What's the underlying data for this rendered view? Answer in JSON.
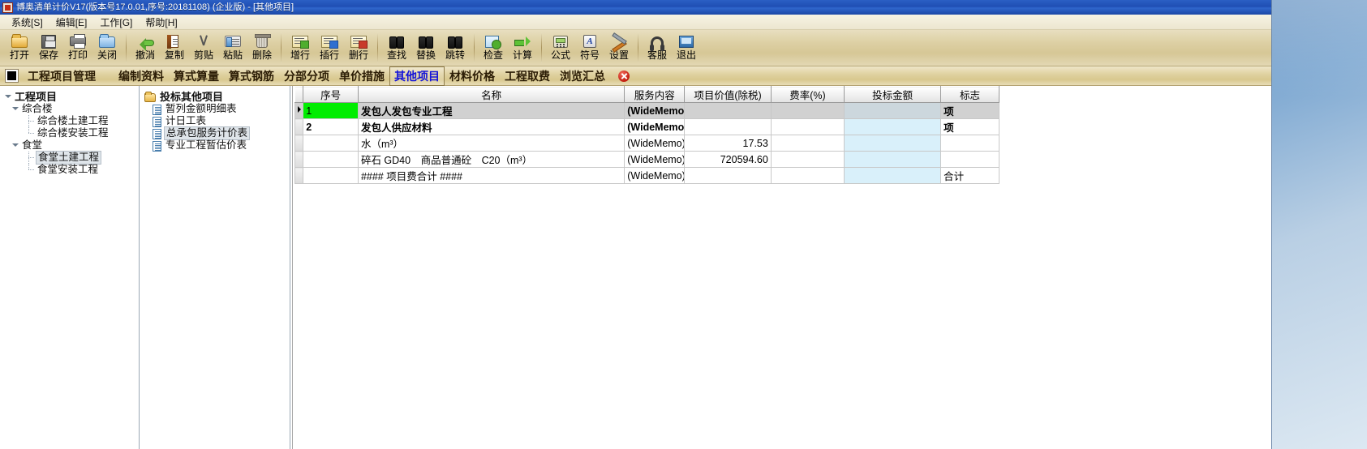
{
  "window": {
    "title": "博奥清单计价V17(版本号17.0.01,序号:20181108) (企业版) - [其他项目]",
    "app_icon": "app-logo-icon"
  },
  "menubar": {
    "items": [
      {
        "label": "系统[S]",
        "name": "menu-system"
      },
      {
        "label": "编辑[E]",
        "name": "menu-edit"
      },
      {
        "label": "工作[G]",
        "name": "menu-work"
      },
      {
        "label": "帮助[H]",
        "name": "menu-help"
      }
    ]
  },
  "toolbar": {
    "groups": [
      {
        "buttons": [
          {
            "label": "打开",
            "icon": "open-folder-icon"
          },
          {
            "label": "保存",
            "icon": "save-disk-icon"
          },
          {
            "label": "打印",
            "icon": "printer-icon"
          },
          {
            "label": "关闭",
            "icon": "close-folder-icon"
          }
        ]
      },
      {
        "buttons": [
          {
            "label": "撤消",
            "icon": "undo-arrow-icon"
          },
          {
            "label": "复制",
            "icon": "copy-icon"
          },
          {
            "label": "剪贴",
            "icon": "scissors-icon"
          },
          {
            "label": "粘贴",
            "icon": "paste-icon"
          },
          {
            "label": "删除",
            "icon": "trash-icon"
          }
        ]
      },
      {
        "buttons": [
          {
            "label": "增行",
            "icon": "add-row-icon"
          },
          {
            "label": "插行",
            "icon": "insert-row-icon"
          },
          {
            "label": "删行",
            "icon": "delete-row-icon"
          }
        ]
      },
      {
        "buttons": [
          {
            "label": "查找",
            "icon": "binoculars-search-icon"
          },
          {
            "label": "替换",
            "icon": "binoculars-replace-icon"
          },
          {
            "label": "跳转",
            "icon": "binoculars-goto-icon"
          }
        ]
      },
      {
        "buttons": [
          {
            "label": "检查",
            "icon": "check-document-icon"
          },
          {
            "label": "计算",
            "icon": "green-arrow-icon"
          }
        ]
      },
      {
        "buttons": [
          {
            "label": "公式",
            "icon": "calculator-icon"
          },
          {
            "label": "符号",
            "icon": "symbol-a-icon"
          },
          {
            "label": "设置",
            "icon": "tools-icon"
          }
        ]
      },
      {
        "buttons": [
          {
            "label": "客服",
            "icon": "headset-icon"
          },
          {
            "label": "退出",
            "icon": "exit-window-icon"
          }
        ]
      }
    ]
  },
  "module_bar": {
    "square_icon": "black-square-icon",
    "primary": "工程项目管理",
    "tabs": [
      {
        "label": "编制资料",
        "active": false
      },
      {
        "label": "算式算量",
        "active": false
      },
      {
        "label": "算式钢筋",
        "active": false
      },
      {
        "label": "分部分项",
        "active": false
      },
      {
        "label": "单价措施",
        "active": false
      },
      {
        "label": "其他项目",
        "active": true
      },
      {
        "label": "材料价格",
        "active": false
      },
      {
        "label": "工程取费",
        "active": false
      },
      {
        "label": "浏览汇总",
        "active": false
      }
    ],
    "close_icon": "close-circle-icon"
  },
  "project_tree": {
    "root": "工程项目",
    "nodes": [
      {
        "label": "综合楼",
        "level": 1,
        "selected": false,
        "expandable": true
      },
      {
        "label": "综合楼土建工程",
        "level": 2,
        "selected": false,
        "expandable": false
      },
      {
        "label": "综合楼安装工程",
        "level": 2,
        "selected": false,
        "expandable": false
      },
      {
        "label": "食堂",
        "level": 1,
        "selected": false,
        "expandable": true
      },
      {
        "label": "食堂土建工程",
        "level": 2,
        "selected": true,
        "expandable": false
      },
      {
        "label": "食堂安装工程",
        "level": 2,
        "selected": false,
        "expandable": false
      }
    ]
  },
  "sheet_tree": {
    "root": "投标其他项目",
    "items": [
      {
        "label": "暂列金额明细表",
        "selected": false
      },
      {
        "label": "计日工表",
        "selected": false
      },
      {
        "label": "总承包服务计价表",
        "selected": true
      },
      {
        "label": "专业工程暂估价表",
        "selected": false
      }
    ]
  },
  "grid": {
    "columns": [
      {
        "key": "seq",
        "label": "序号"
      },
      {
        "key": "name",
        "label": "名称"
      },
      {
        "key": "serv",
        "label": "服务内容"
      },
      {
        "key": "val",
        "label": "项目价值(除税)"
      },
      {
        "key": "rate",
        "label": "费率(%)"
      },
      {
        "key": "bid",
        "label": "投标金额"
      },
      {
        "key": "flag",
        "label": "标志"
      }
    ],
    "rows": [
      {
        "current": true,
        "selected": true,
        "seq_highlight": true,
        "seq": "1",
        "name": "发包人发包专业工程",
        "name_style": "bold-blue",
        "serv": "(WideMemo",
        "serv_style": "memo-blue",
        "val": "",
        "rate": "",
        "bid": "",
        "flag": "项",
        "flag_style": "flag-bold"
      },
      {
        "current": false,
        "selected": false,
        "seq_highlight": false,
        "seq": "2",
        "name": "发包人供应材料",
        "name_style": "bold-blue",
        "serv": "(WideMemo",
        "serv_style": "memo-blue",
        "val": "",
        "rate": "",
        "bid": "",
        "flag": "项",
        "flag_style": "flag-bold"
      },
      {
        "current": false,
        "selected": false,
        "seq_highlight": false,
        "seq": "",
        "name": "水（m³）",
        "name_style": "",
        "serv": "(WideMemo)",
        "serv_style": "memo-gray",
        "val": "17.53",
        "rate": "",
        "bid": "",
        "flag": "",
        "flag_style": ""
      },
      {
        "current": false,
        "selected": false,
        "seq_highlight": false,
        "seq": "",
        "name": "碎石 GD40　商品普通砼　C20（m³）",
        "name_style": "",
        "serv": "(WideMemo)",
        "serv_style": "memo-gray",
        "val": "720594.60",
        "rate": "",
        "bid": "",
        "flag": "",
        "flag_style": ""
      },
      {
        "current": false,
        "selected": false,
        "seq_highlight": false,
        "seq": "",
        "name": "#### 项目费合计 ####",
        "name_style": "red",
        "serv": "(WideMemo)",
        "serv_style": "memo-gray red",
        "val": "",
        "rate": "",
        "bid": "",
        "flag": "合计",
        "flag_style": "red"
      }
    ]
  }
}
